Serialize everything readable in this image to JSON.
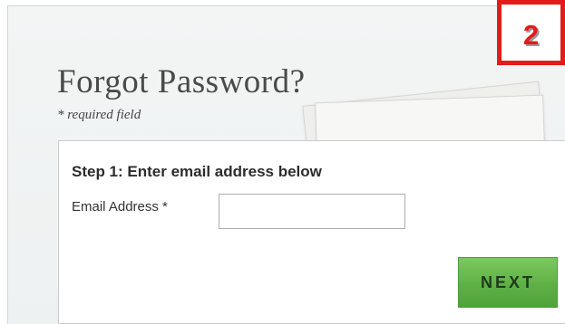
{
  "step_badge": {
    "number": "2",
    "color": "#e31b1b"
  },
  "page": {
    "title": "Forgot Password?",
    "required_note": "* required field"
  },
  "form": {
    "step_heading": "Step 1: Enter email address below",
    "email_label": "Email Address *",
    "email_value": "",
    "email_placeholder": "",
    "next_button_label": "NEXT",
    "next_button_color": "#5fb146"
  }
}
